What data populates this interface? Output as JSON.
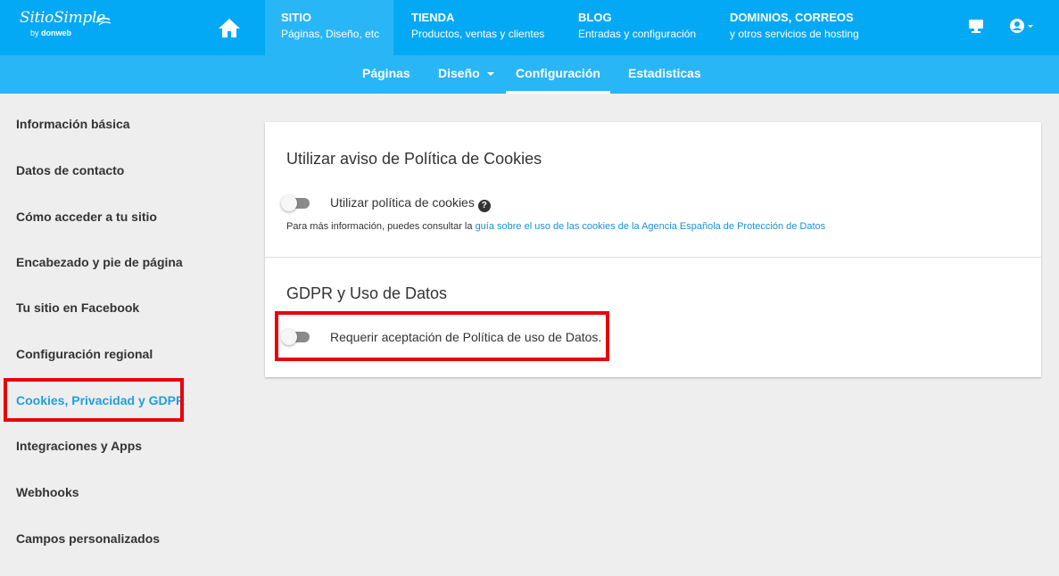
{
  "brand": {
    "name": "SitioSimple",
    "by": "by",
    "company": "donweb"
  },
  "topnav": [
    {
      "title": "SITIO",
      "subtitle": "Páginas, Diseño, etc"
    },
    {
      "title": "TIENDA",
      "subtitle": "Productos, ventas y clientes"
    },
    {
      "title": "BLOG",
      "subtitle": "Entradas y configuración"
    },
    {
      "title": "DOMINIOS, CORREOS",
      "subtitle": "y otros servicios de hosting"
    }
  ],
  "subnav": {
    "paginas": "Páginas",
    "diseno": "Diseño",
    "configuracion": "Configuración",
    "estadisticas": "Estadisticas"
  },
  "sidebar": {
    "items": [
      "Información básica",
      "Datos de contacto",
      "Cómo acceder a tu sitio",
      "Encabezado y pie de página",
      "Tu sitio en Facebook",
      "Configuración regional",
      "Cookies, Privacidad y GDPR",
      "Integraciones y Apps",
      "Webhooks",
      "Campos personalizados"
    ],
    "active_index": 6
  },
  "cookies_section": {
    "heading": "Utilizar aviso de Política de Cookies",
    "toggle_label": "Utilizar política de cookies",
    "toggle_on": false,
    "help_glyph": "?",
    "info_prefix": "Para más información, puedes consultar la ",
    "info_link": "guía sobre el uso de las cookies de la Agencia Española de Protección de Datos"
  },
  "gdpr_section": {
    "heading": "GDPR y Uso de Datos",
    "toggle_label": "Requerir aceptación de Política de uso de Datos.",
    "toggle_on": false
  },
  "colors": {
    "topbar": "#03a9f4",
    "subbar": "#29b6f6",
    "active_link": "#1ea0dc",
    "highlight": "#e8000e"
  },
  "icons": {
    "home": "home-icon",
    "desktop": "desktop-icon",
    "account": "account-icon",
    "caret": "caret-down-icon",
    "help": "help-icon"
  }
}
